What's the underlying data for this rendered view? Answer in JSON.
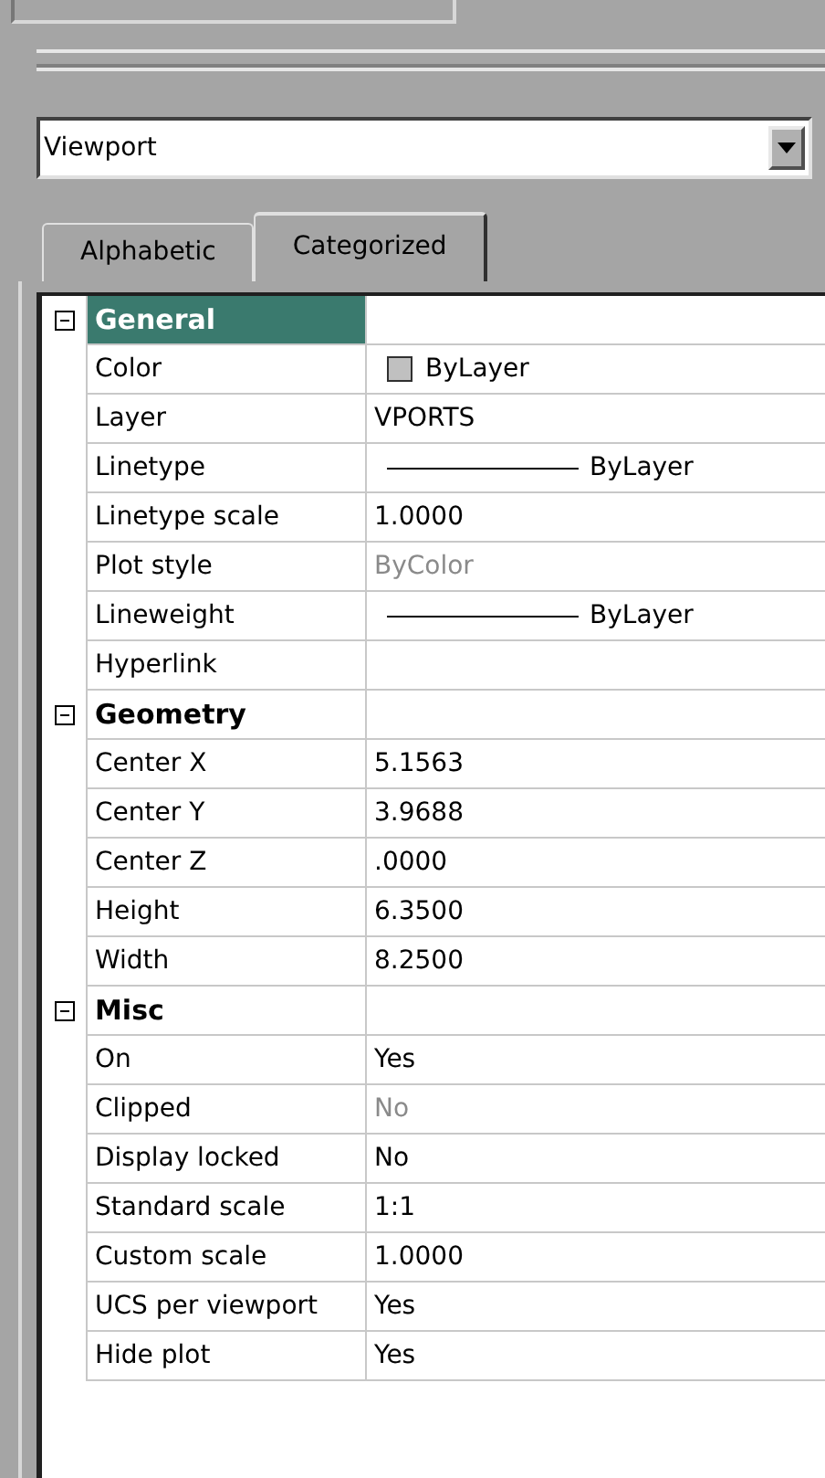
{
  "object_select": {
    "value": "Viewport"
  },
  "tabs": [
    {
      "label": "Alphabetic",
      "selected": false
    },
    {
      "label": "Categorized",
      "selected": true
    }
  ],
  "groups": [
    {
      "title": "General",
      "expanded": true,
      "selected": true,
      "rows": [
        {
          "name": "Color",
          "value": "ByLayer",
          "kind": "swatch",
          "disabled": false
        },
        {
          "name": "Layer",
          "value": "VPORTS",
          "kind": "text",
          "disabled": false
        },
        {
          "name": "Linetype",
          "value": "ByLayer",
          "kind": "line",
          "disabled": false
        },
        {
          "name": "Linetype scale",
          "value": "1.0000",
          "kind": "text",
          "disabled": false
        },
        {
          "name": "Plot style",
          "value": "ByColor",
          "kind": "text",
          "disabled": true
        },
        {
          "name": "Lineweight",
          "value": "ByLayer",
          "kind": "line",
          "disabled": false
        },
        {
          "name": "Hyperlink"
        }
      ]
    },
    {
      "title": "Geometry",
      "expanded": true,
      "selected": false,
      "rows": [
        {
          "name": "Center X",
          "value": "5.1563",
          "kind": "text",
          "disabled": false
        },
        {
          "name": "Center Y",
          "value": "3.9688",
          "kind": "text",
          "disabled": false
        },
        {
          "name": "Center Z",
          "value": ".0000",
          "kind": "text",
          "disabled": false
        },
        {
          "name": "Height",
          "value": "6.3500",
          "kind": "text",
          "disabled": false
        },
        {
          "name": "Width",
          "value": "8.2500",
          "kind": "text",
          "disabled": false
        }
      ]
    },
    {
      "title": "Misc",
      "expanded": true,
      "selected": false,
      "rows": [
        {
          "name": "On",
          "value": "Yes",
          "kind": "text",
          "disabled": false
        },
        {
          "name": "Clipped",
          "value": "No",
          "kind": "text",
          "disabled": true
        },
        {
          "name": "Display locked",
          "value": "No",
          "kind": "text",
          "disabled": false
        },
        {
          "name": "Standard scale",
          "value": "1:1",
          "kind": "text",
          "disabled": false
        },
        {
          "name": "Custom scale",
          "value": "1.0000",
          "kind": "text",
          "disabled": false
        },
        {
          "name": "UCS per viewport",
          "value": "Yes",
          "kind": "text",
          "disabled": false
        },
        {
          "name": "Hide plot",
          "value": "Yes",
          "kind": "text",
          "disabled": false
        }
      ]
    }
  ]
}
